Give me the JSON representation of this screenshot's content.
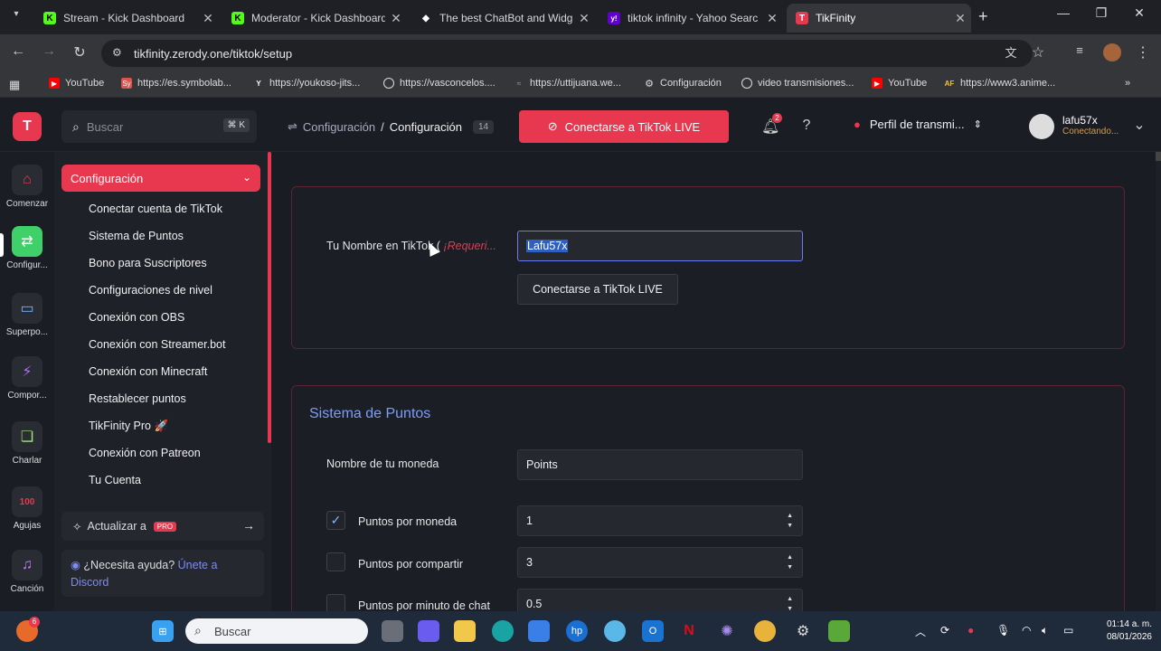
{
  "browser": {
    "tabs": [
      {
        "title": "Stream - Kick Dashboard",
        "fav": "K",
        "favColor": "#53fc18",
        "active": false
      },
      {
        "title": "Moderator - Kick Dashboard",
        "fav": "K",
        "favColor": "#53fc18",
        "active": false
      },
      {
        "title": "The best ChatBot and Widg",
        "fav": "◆",
        "favColor": "#ffffff",
        "active": false
      },
      {
        "title": "tiktok infinity - Yahoo Searc",
        "fav": "y!",
        "favColor": "#6001d2",
        "active": false
      },
      {
        "title": "TikFinity",
        "fav": "T",
        "favColor": "#e8384f",
        "active": true
      }
    ],
    "url": "tikfinity.zerody.one/tiktok/setup",
    "bookmarks": [
      "YouTube",
      "https://es.symbolab...",
      "https://youkoso-jits...",
      "https://vasconcelos....",
      "https://uttijuana.we...",
      "Configuración",
      "video transmisiones...",
      "YouTube",
      "https://www3.anime..."
    ]
  },
  "header": {
    "logo": "T",
    "search_placeholder": "Buscar",
    "search_kbd": "⌘ K",
    "breadcrumb_parent": "Configuración",
    "breadcrumb_sep": "/",
    "breadcrumb_current": "Configuración",
    "breadcrumb_count": "14",
    "connect_label": "Conectarse a TikTok LIVE",
    "notif_count": "2",
    "profile_label": "Perfil de transmi...",
    "user_name": "lafu57x",
    "user_status": "Conectando..."
  },
  "rail": [
    {
      "label": "Comenzar",
      "icon": "⌂",
      "color": "#e8384f",
      "bg": "transparent"
    },
    {
      "label": "Configur...",
      "icon": "⇄",
      "color": "#ffffff",
      "bg": "#3fd06a"
    },
    {
      "label": "Superpo...",
      "icon": "▭",
      "color": "#6fb4ff",
      "bg": "transparent"
    },
    {
      "label": "Compor...",
      "icon": "⚡",
      "color": "#b46bff",
      "bg": "transparent"
    },
    {
      "label": "Charlar",
      "icon": "▢",
      "color": "#a6e07a",
      "bg": "transparent"
    },
    {
      "label": "Agujas",
      "icon": "100",
      "color": "#e8384f",
      "bg": "transparent"
    },
    {
      "label": "Canción",
      "icon": "♫",
      "color": "#c27cff",
      "bg": "transparent"
    }
  ],
  "sidebar": {
    "heading": "Configuración",
    "items": [
      "Conectar cuenta de TikTok",
      "Sistema de Puntos",
      "Bono para Suscriptores",
      "Configuraciones de nivel",
      "Conexión con OBS",
      "Conexión con Streamer.bot",
      "Conexión con Minecraft",
      "Restablecer puntos",
      "TikFinity Pro 🚀",
      "Conexión con Patreon",
      "Tu Cuenta"
    ],
    "upgrade_label": "Actualizar a",
    "upgrade_badge": "PRO",
    "help_text": "¿Necesita ayuda?",
    "help_link1": "Únete a",
    "help_link2": "Discord"
  },
  "account_card": {
    "label": "Tu Nombre en TikTok (",
    "required": "¡Requeri...",
    "value": "Lafu57x",
    "button": "Conectarse a TikTok LIVE"
  },
  "points_card": {
    "title": "Sistema de Puntos",
    "currency_label": "Nombre de tu moneda",
    "currency_value": "Points",
    "rows": [
      {
        "label": "Puntos por moneda",
        "value": "1",
        "checked": true
      },
      {
        "label": "Puntos por compartir",
        "value": "3",
        "checked": false
      },
      {
        "label": "Puntos por minuto de chat",
        "value": "0.5",
        "checked": false
      }
    ]
  },
  "taskbar": {
    "search_placeholder": "Buscar",
    "time": "01:14 a. m.",
    "date": "08/01/2026",
    "weather_badge": "6"
  }
}
